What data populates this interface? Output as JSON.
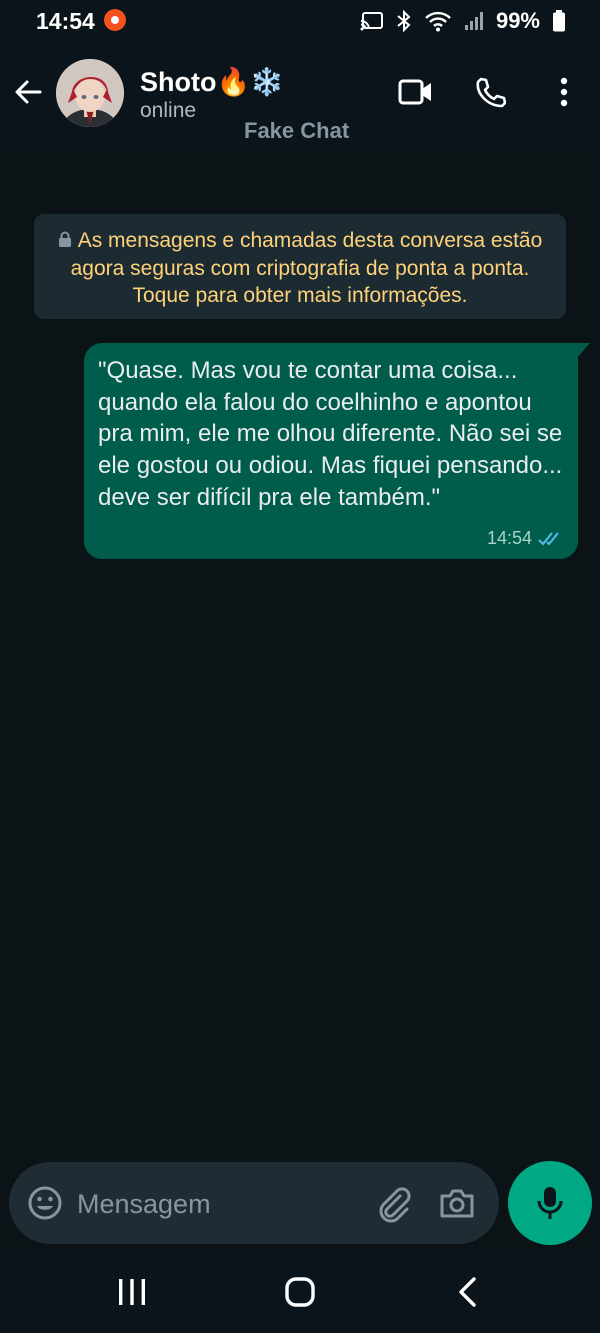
{
  "status_bar": {
    "time": "14:54",
    "battery": "99%"
  },
  "header": {
    "contact_name": "Shoto🔥❄️",
    "contact_status": "online",
    "brand_label": "Fake Chat"
  },
  "encryption_notice": {
    "text": "As mensagens e chamadas desta conversa estão agora seguras com criptografia de ponta a ponta. Toque para obter mais informações."
  },
  "messages": [
    {
      "direction": "outgoing",
      "text": "\"Quase. Mas vou te contar uma coisa... quando ela falou do coelhinho e apontou pra mim, ele me olhou diferente. Não sei se ele gostou ou odiou. Mas fiquei pensando... deve ser difícil pra ele também.\"",
      "time": "14:54",
      "status": "read"
    }
  ],
  "composer": {
    "placeholder": "Mensagem"
  },
  "colors": {
    "app_background": "#0b141a",
    "outgoing_bubble": "#005c4b",
    "notice_text": "#ffd279",
    "accent": "#00a884",
    "read_ticks": "#53bdeb"
  },
  "icons": {
    "recording": "screen-record-icon",
    "cast": "cast-icon",
    "bluetooth": "bluetooth-icon",
    "wifi": "wifi-icon",
    "signal": "signal-icon",
    "battery": "battery-icon",
    "back": "arrow-left-icon",
    "video": "video-camera-icon",
    "call": "phone-icon",
    "menu": "more-vertical-icon",
    "lock": "lock-icon",
    "ticks": "double-check-icon",
    "emoji": "emoji-icon",
    "attach": "paperclip-icon",
    "camera": "camera-icon",
    "mic": "microphone-icon",
    "nav_recents": "recents-icon",
    "nav_home": "home-icon",
    "nav_back": "chevron-left-icon"
  }
}
